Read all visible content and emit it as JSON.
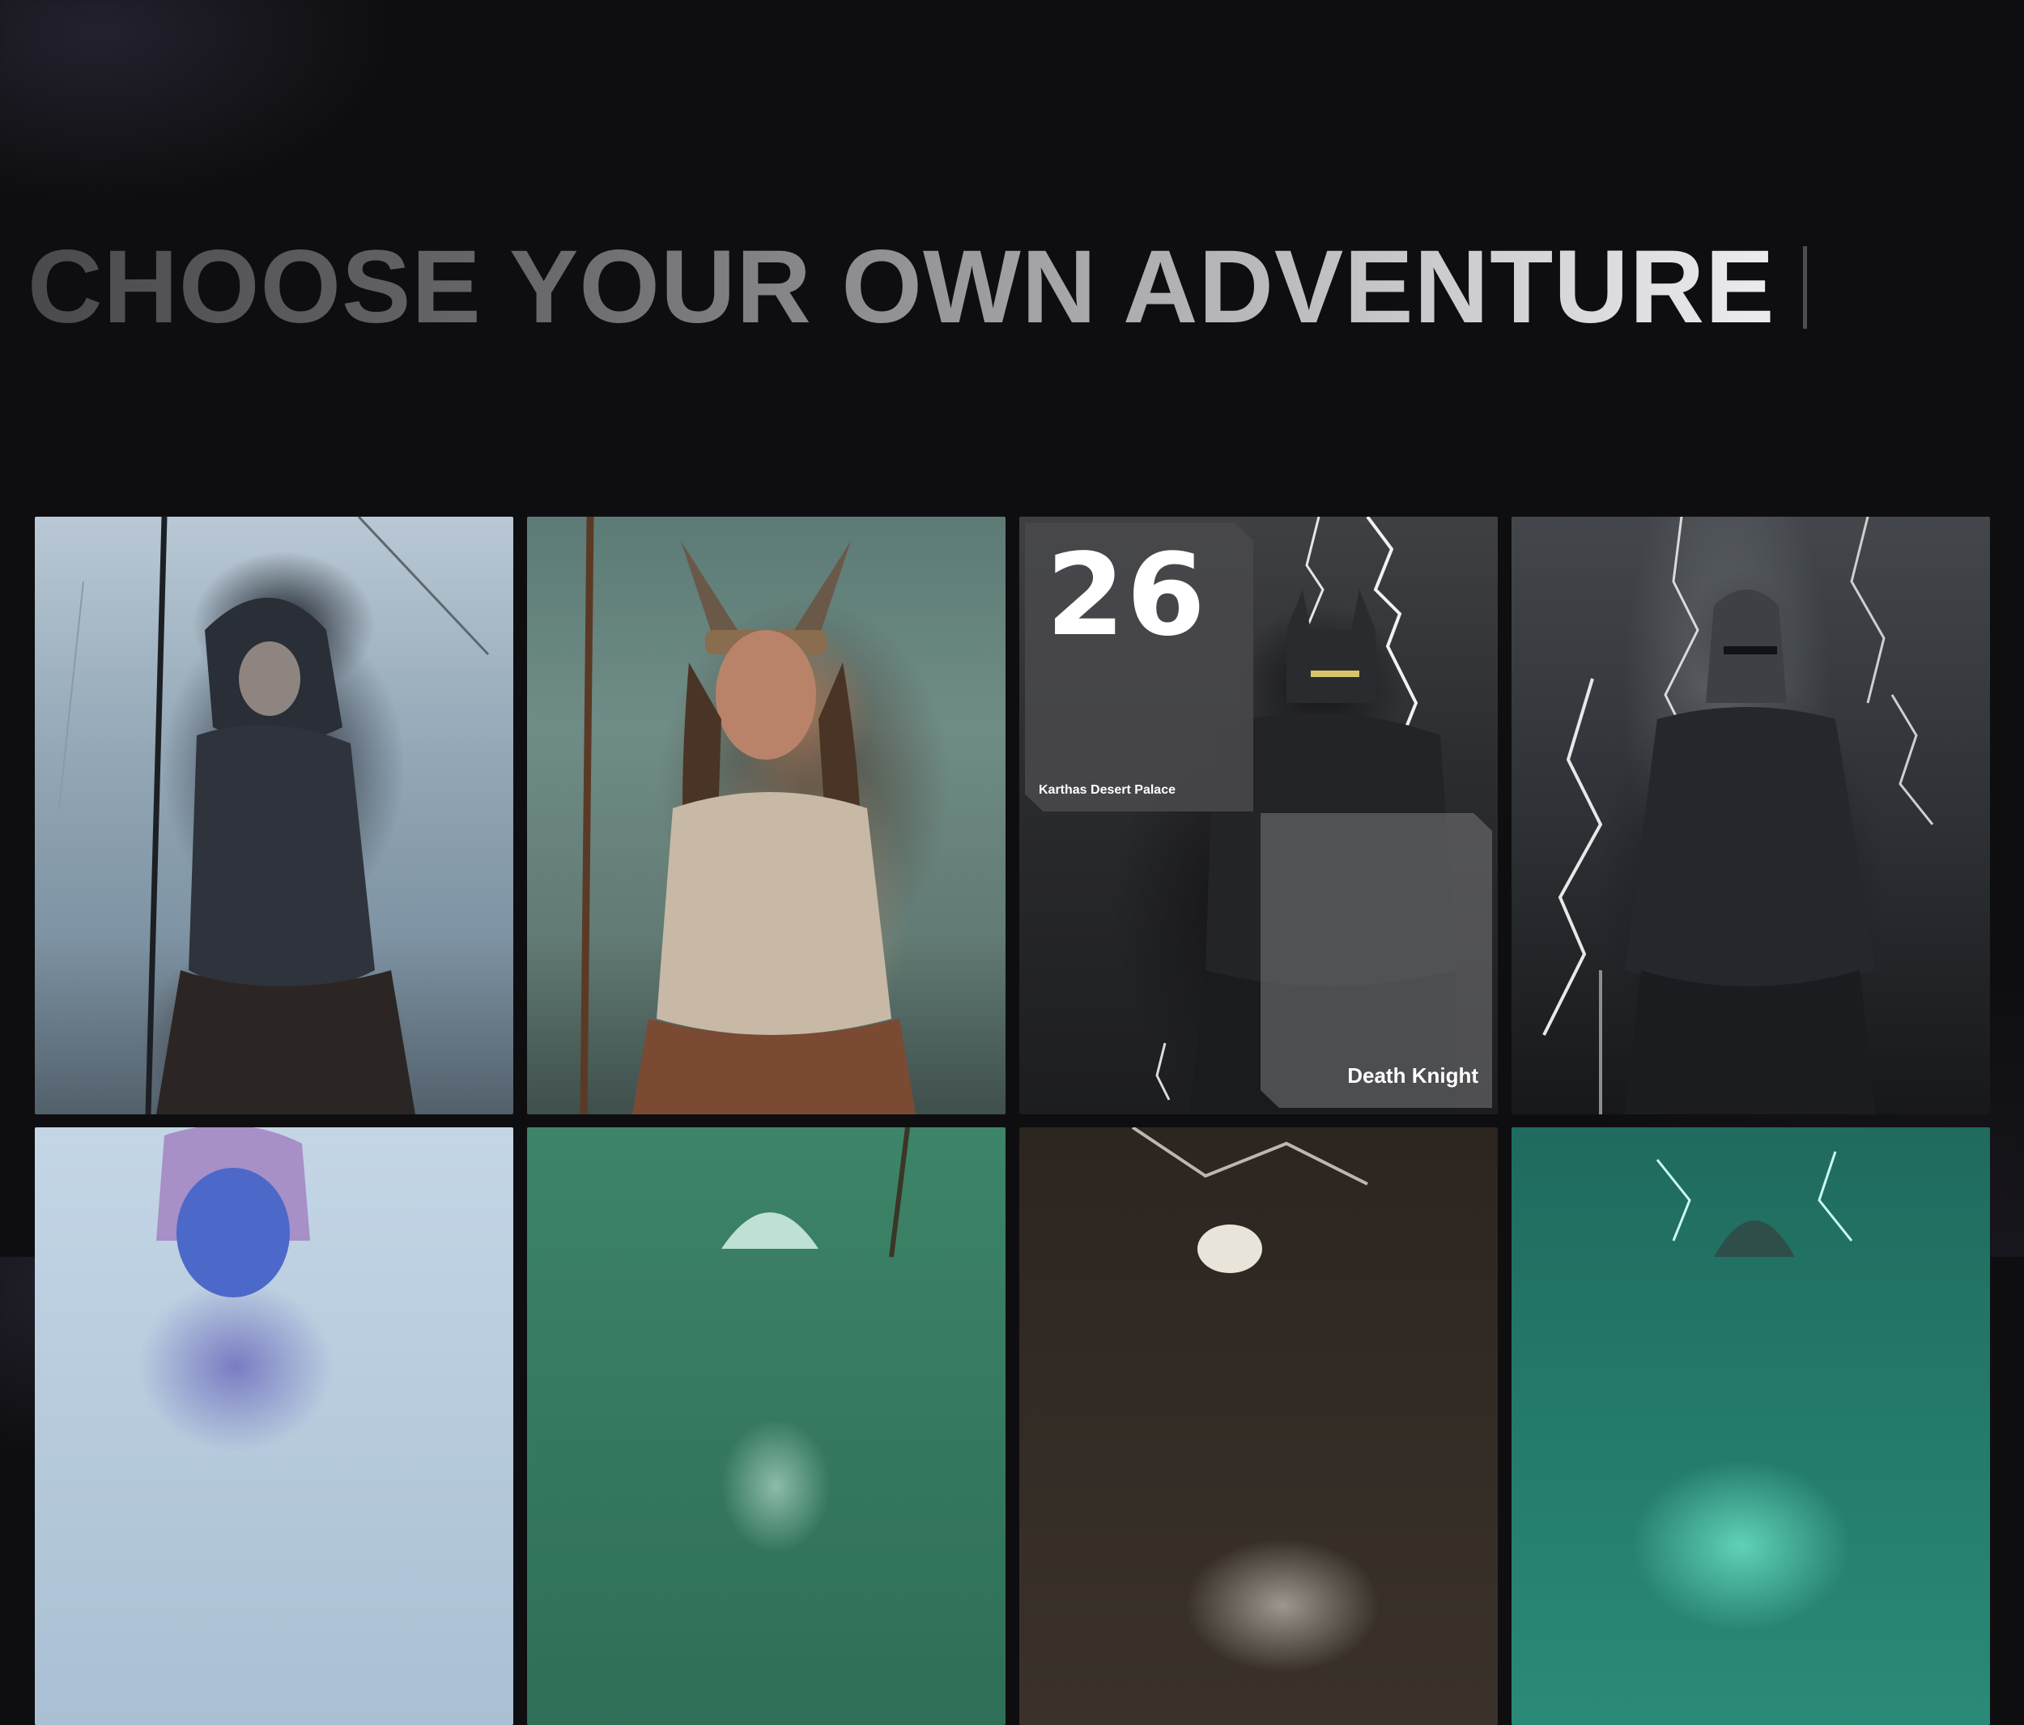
{
  "headline": {
    "text": "CHOOSE YOUR OWN ADVENTURE"
  },
  "cards": [
    {
      "art_icon": "hooded-ranger-art"
    },
    {
      "art_icon": "warrior-woman-art"
    },
    {
      "art_icon": "death-knight-art",
      "number": "26",
      "location": "Karthas Desert Palace",
      "name": "Death Knight"
    },
    {
      "art_icon": "armored-knight-art"
    },
    {
      "art_icon": "blue-faced-sorceress-art"
    },
    {
      "art_icon": "green-hooded-figure-art"
    },
    {
      "art_icon": "dark-storm-art"
    },
    {
      "art_icon": "teal-hooded-mage-art"
    }
  ],
  "colors": {
    "background": "#0e0e10",
    "headline_start": "#4a4a4d",
    "headline_end": "#ececee",
    "panel": "#48484b"
  }
}
